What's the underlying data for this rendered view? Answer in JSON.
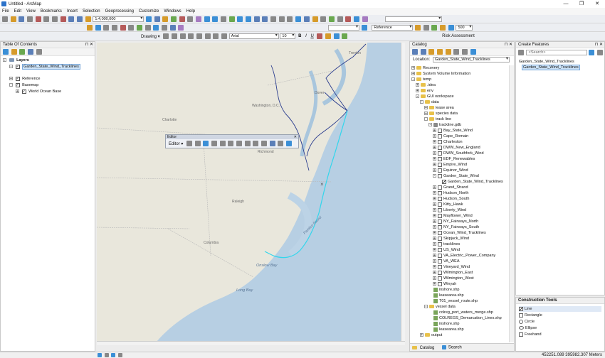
{
  "window": {
    "title": "Untitled - ArcMap",
    "controls": [
      "—",
      "❐",
      "✕"
    ]
  },
  "menu": [
    "File",
    "Edit",
    "View",
    "Bookmarks",
    "Insert",
    "Selection",
    "Geoprocessing",
    "Customize",
    "Windows",
    "Help"
  ],
  "toolbar": {
    "scale": "1:4,000,000",
    "drawing_label": "Drawing ▾",
    "font_name": "Arial",
    "font_size": "10",
    "bold": "B",
    "italic": "I",
    "underline": "U",
    "reference_combo": "Reference",
    "risk_assessment": "Risk Assessment",
    "zoom_value": "500"
  },
  "toc": {
    "title": "Table Of Contents",
    "items": [
      {
        "label": "Layers",
        "bold": true
      },
      {
        "label": "Garden_State_Wind_Tracklines"
      },
      {
        "label": "Reference"
      },
      {
        "label": "Basemap"
      },
      {
        "label": "World Ocean Base"
      }
    ]
  },
  "catalog": {
    "title": "Catalog",
    "location_label": "Location:",
    "location_value": "Garden_State_Wind_Tracklines",
    "items": [
      "Recovery",
      "System Volume Information",
      "temp",
      ".idea",
      "env",
      "GUI workspace",
      "data",
      "lease area",
      "species data",
      "track line",
      "trackline.gdb",
      "Bay_State_Wind",
      "Cape_Romain",
      "Charleston",
      "DWW_New_England",
      "DWW_Southfork_Wind",
      "EDF_Renewables",
      "Empire_Wind",
      "Equinor_Wind",
      "Garden_State_Wind",
      "Garden_State_Wind_Tracklines",
      "Grand_Strand",
      "Hudson_North",
      "Hudson_South",
      "Kitty_Hawk",
      "Liberty_Wind",
      "Mayflower_Wind",
      "NY_Fairways_North",
      "NY_Fairways_South",
      "Ocean_Wind_Tracklines",
      "Skipjack_Wind",
      "tracklines",
      "US_Wind",
      "VA_Electric_Power_Company",
      "VA_WEA",
      "Vineyard_Wind",
      "Wilmington_East",
      "Wilmington_West",
      "Winyah",
      "inshore.shp",
      "leasearea.shp",
      "T01_vessel_route.shp",
      "vessel data",
      "colreg_port_waters_merge.shp",
      "COLREGS_Demarcation_Lines.shp",
      "inshore.shp",
      "leasearea.shp",
      "output"
    ],
    "tabs": [
      "Catalog",
      "Search"
    ]
  },
  "create_features": {
    "title": "Create Features",
    "search_placeholder": "<Search>",
    "template_group": "Garden_State_Wind_Tracklines",
    "template_item": "Garden_State_Wind_Tracklines"
  },
  "construction_tools": {
    "title": "Construction Tools",
    "items": [
      "Line",
      "Rectangle",
      "Circle",
      "Ellipse",
      "Freehand"
    ]
  },
  "editor": {
    "title": "Editor",
    "menu_label": "Editor ▾"
  },
  "map": {
    "labels": [
      "Washington, D.C.",
      "Richmond",
      "Raleigh",
      "Charlotte",
      "Columbia",
      "Onslow Bay",
      "Long Bay",
      "Pamlico Sound",
      "Trenton",
      "Dover"
    ]
  },
  "status": {
    "coords": "452251.089  395982.307 Meters"
  }
}
